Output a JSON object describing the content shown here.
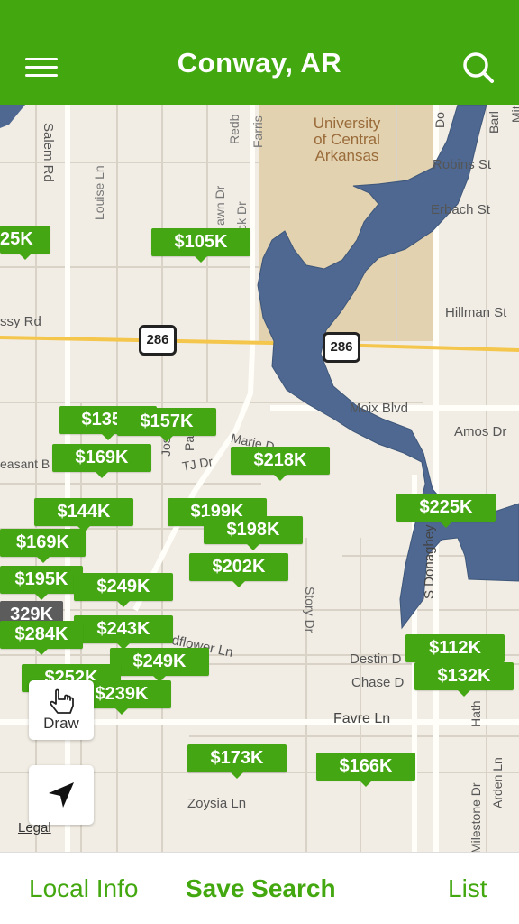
{
  "header": {
    "title": "Conway, AR",
    "menu_icon": "hamburger-menu-icon",
    "search_icon": "search-icon",
    "color": "#43a80f"
  },
  "map": {
    "place_labels": [
      "University",
      "of Central",
      "Arkansas"
    ],
    "streets": {
      "salem": "Salem Rd",
      "louise": "Louise Ln",
      "redb": "Redb",
      "farris": "Farris",
      "robins": "Robins St",
      "erbach": "Erbach St",
      "hillman": "Hillman St",
      "moix": "Moix Blvd",
      "amos": "Amos Dr",
      "ssy": "ssy Rd",
      "easant": "easant B",
      "tj": "TJ Dr",
      "marie": "Marie D",
      "story": "Story Dr",
      "destin": "Destin D",
      "chase": "Chase D",
      "favre": "Favre Ln",
      "zoysia": "Zoysia Ln",
      "milestone": "Milestone Dr",
      "arden": "Arden Ln",
      "donaghey": "S Donaghey Ave",
      "dflower": "dflower Ln",
      "hath": "Hath",
      "rock": "mrock Dr",
      "awn": "awn Dr",
      "jose": "Jose",
      "pau": "Pau",
      "do": "Do",
      "barl": "Barl",
      "mit": "Mit",
      "cl": "Cl",
      "dr": "Dr"
    },
    "route_shields": [
      "286",
      "286"
    ],
    "prices": [
      {
        "label": "25K"
      },
      {
        "label": "$105K"
      },
      {
        "label": "$135K"
      },
      {
        "label": "$157K"
      },
      {
        "label": "$169K"
      },
      {
        "label": "$218K"
      },
      {
        "label": "$144K"
      },
      {
        "label": "$199K"
      },
      {
        "label": "$198K"
      },
      {
        "label": "$225K"
      },
      {
        "label": "$169K"
      },
      {
        "label": "$202K"
      },
      {
        "label": "$195K"
      },
      {
        "label": "$249K"
      },
      {
        "label": "329K"
      },
      {
        "label": "$243K"
      },
      {
        "label": "$284K"
      },
      {
        "label": "$249K"
      },
      {
        "label": "$112K"
      },
      {
        "label": "$252K"
      },
      {
        "label": "$132K"
      },
      {
        "label": "$239K"
      },
      {
        "label": "$173K"
      },
      {
        "label": "$166K"
      }
    ],
    "draw_label": "Draw",
    "draw_icon": "hand-pointer-icon",
    "location_icon": "location-arrow-icon",
    "legal": "Legal"
  },
  "footer": {
    "local_info": "Local Info",
    "save_search": "Save Search",
    "list": "List"
  }
}
